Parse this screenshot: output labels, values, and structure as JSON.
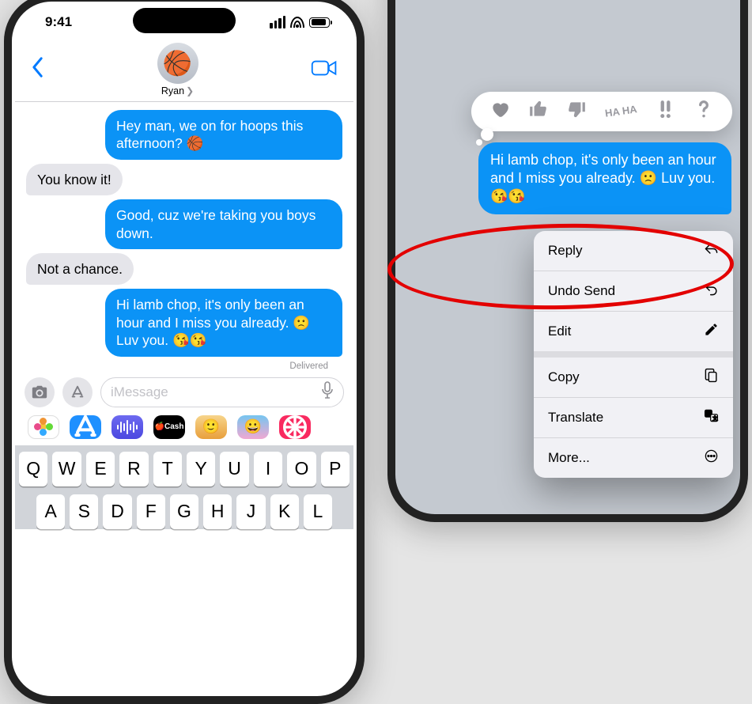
{
  "status": {
    "time": "9:41"
  },
  "header": {
    "contact_name": "Ryan",
    "avatar_emoji": "🏀"
  },
  "messages": [
    {
      "dir": "out",
      "text": "Hey man, we on for hoops this afternoon? 🏀"
    },
    {
      "dir": "in",
      "text": "You know it!"
    },
    {
      "dir": "out",
      "text": "Good, cuz we're taking you boys down."
    },
    {
      "dir": "in",
      "text": "Not a chance."
    },
    {
      "dir": "out",
      "text": "Hi lamb chop, it's only been an hour and I miss you already. 🙁 Luv you. 😘😘"
    }
  ],
  "delivered_label": "Delivered",
  "input": {
    "placeholder": "iMessage",
    "cash_label": "🍎Cash"
  },
  "keyboard": {
    "row1": [
      "Q",
      "W",
      "E",
      "R",
      "T",
      "Y",
      "U",
      "I",
      "O",
      "P"
    ],
    "row2": [
      "A",
      "S",
      "D",
      "F",
      "G",
      "H",
      "J",
      "K",
      "L"
    ]
  },
  "focus_message": "Hi lamb chop, it's only been an hour and I miss you already. 🙁 Luv you. 😘😘",
  "tapback": {
    "haha_label": "HA HA"
  },
  "menu": {
    "reply": "Reply",
    "undo_send": "Undo Send",
    "edit": "Edit",
    "copy": "Copy",
    "translate": "Translate",
    "more": "More..."
  }
}
